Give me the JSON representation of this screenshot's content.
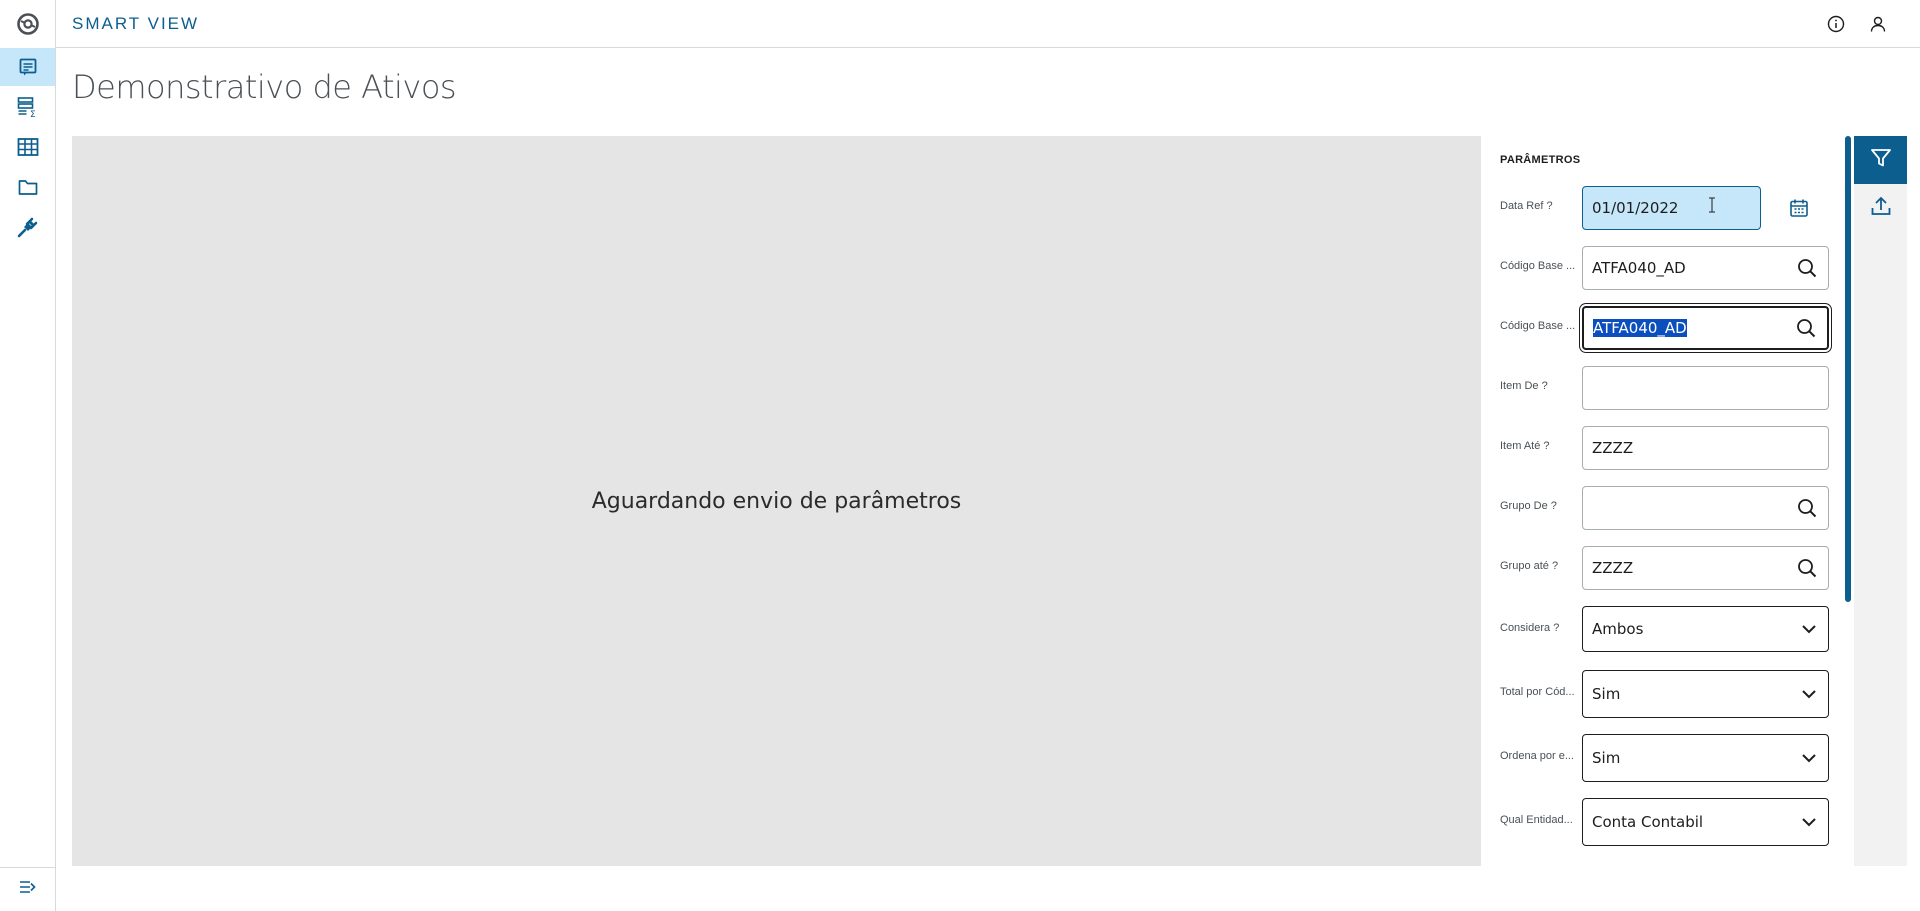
{
  "header": {
    "brand": "SMART VIEW",
    "info_icon": "info-icon",
    "user_icon": "user-icon"
  },
  "sidebar": {
    "logo_icon": "totvs-logo-icon",
    "items": [
      {
        "name": "reports",
        "icon": "report-icon",
        "active": true
      },
      {
        "name": "data-view",
        "icon": "table-sum-icon",
        "active": false
      },
      {
        "name": "grid",
        "icon": "grid-icon",
        "active": false
      },
      {
        "name": "folder",
        "icon": "folder-icon",
        "active": false
      },
      {
        "name": "plugin",
        "icon": "plug-icon",
        "active": false
      }
    ],
    "collapse_icon": "collapse-menu-icon"
  },
  "page": {
    "title": "Demonstrativo de Ativos"
  },
  "report": {
    "message": "Aguardando envio de parâmetros"
  },
  "params": {
    "title": "PARÂMETROS",
    "fields": [
      {
        "label": "Data Ref ?",
        "value": "01/01/2022",
        "type": "date",
        "icon": "calendar-icon"
      },
      {
        "label": "Código Base ...",
        "value": "ATFA040_AD",
        "type": "lookup",
        "icon": "search-icon"
      },
      {
        "label": "Código Base ...",
        "value": "ATFA040_AD",
        "type": "lookup",
        "icon": "search-icon",
        "focused": true
      },
      {
        "label": "Item De ?",
        "value": "",
        "type": "text"
      },
      {
        "label": "Item Até ?",
        "value": "ZZZZ",
        "type": "text"
      },
      {
        "label": "Grupo De ?",
        "value": "",
        "type": "lookup",
        "icon": "search-icon"
      },
      {
        "label": "Grupo até ?",
        "value": "ZZZZ",
        "type": "lookup",
        "icon": "search-icon"
      },
      {
        "label": "Considera ?",
        "value": "Ambos",
        "type": "select",
        "icon": "chevron-down-icon"
      },
      {
        "label": "Total por Cód...",
        "value": "Sim",
        "type": "select",
        "icon": "chevron-down-icon"
      },
      {
        "label": "Ordena por e...",
        "value": "Sim",
        "type": "select",
        "icon": "chevron-down-icon"
      },
      {
        "label": "Qual Entidad...",
        "value": "Conta Contabil",
        "type": "select",
        "icon": "chevron-down-icon"
      }
    ]
  },
  "toolbar": {
    "filter_icon": "filter-icon",
    "export_icon": "upload-icon"
  },
  "colors": {
    "brand": "#0c5e8e",
    "active_bg": "#c6e6fa",
    "report_bg": "#e5e5e5"
  }
}
